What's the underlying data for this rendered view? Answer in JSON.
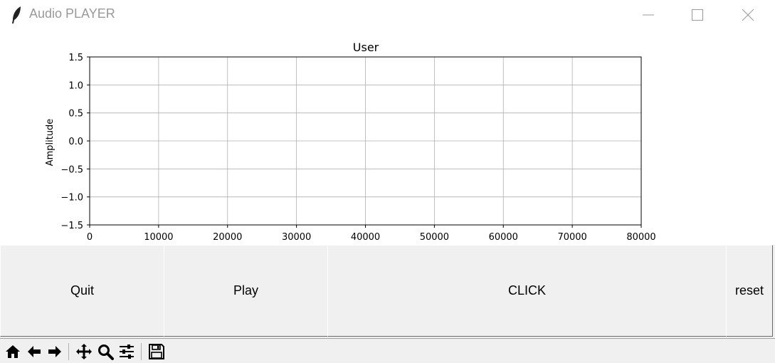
{
  "window": {
    "title": "Audio PLAYER",
    "icons": [
      "feather-icon",
      "minimize-icon",
      "maximize-icon",
      "close-icon"
    ]
  },
  "chart_data": {
    "type": "line",
    "title": "User",
    "xlabel": "",
    "ylabel": "Amplitude",
    "xlim": [
      0,
      80000
    ],
    "ylim": [
      -1.5,
      1.5
    ],
    "xticks": [
      "0",
      "10000",
      "20000",
      "30000",
      "40000",
      "50000",
      "60000",
      "70000",
      "80000"
    ],
    "yticks": [
      "1.5",
      "1.0",
      "0.5",
      "0.0",
      "−0.5",
      "−1.0",
      "−1.5"
    ],
    "grid": true,
    "series": []
  },
  "buttons": {
    "quit": "Quit",
    "play": "Play",
    "click": "CLICK",
    "reset": "reset"
  },
  "toolbar": {
    "icons": [
      "home-icon",
      "back-icon",
      "forward-icon",
      "pan-icon",
      "zoom-icon",
      "configure-subplots-icon",
      "save-icon"
    ]
  }
}
